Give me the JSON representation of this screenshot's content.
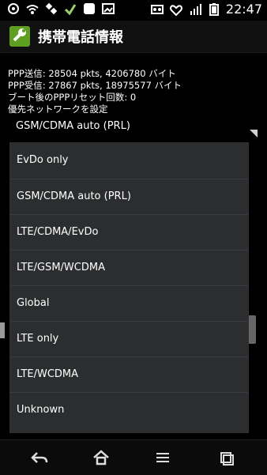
{
  "status": {
    "time": "22:47"
  },
  "app": {
    "title": "携帯電話情報"
  },
  "info": {
    "ppp_sent_label": "PPP送信",
    "ppp_sent_value": ": 28504 pkts, 4206780 バイト",
    "ppp_recv_label": "PPP受信",
    "ppp_recv_value": ": 27867 pkts, 18975577 バイト",
    "boot_reset_label": "ブート後のPPPリセット回数",
    "boot_reset_value": ": 0",
    "preferred_network_label": "優先ネットワークを設定"
  },
  "select": {
    "value": "GSM/CDMA auto (PRL)"
  },
  "dropdown": {
    "options": [
      "EvDo only",
      "GSM/CDMA auto (PRL)",
      "LTE/CDMA/EvDo",
      "LTE/GSM/WCDMA",
      "Global",
      "LTE only",
      "LTE/WCDMA",
      "Unknown"
    ]
  },
  "nav": {
    "icons": [
      "back-icon",
      "home-icon",
      "menu-icon",
      "recent-apps-icon"
    ]
  },
  "colors": {
    "background": "#000000",
    "dropdown_bg": "#2b2d2f",
    "divider": "#3a3c3f",
    "titlebar": "#111111",
    "accent_green": "#5f9f1f"
  }
}
